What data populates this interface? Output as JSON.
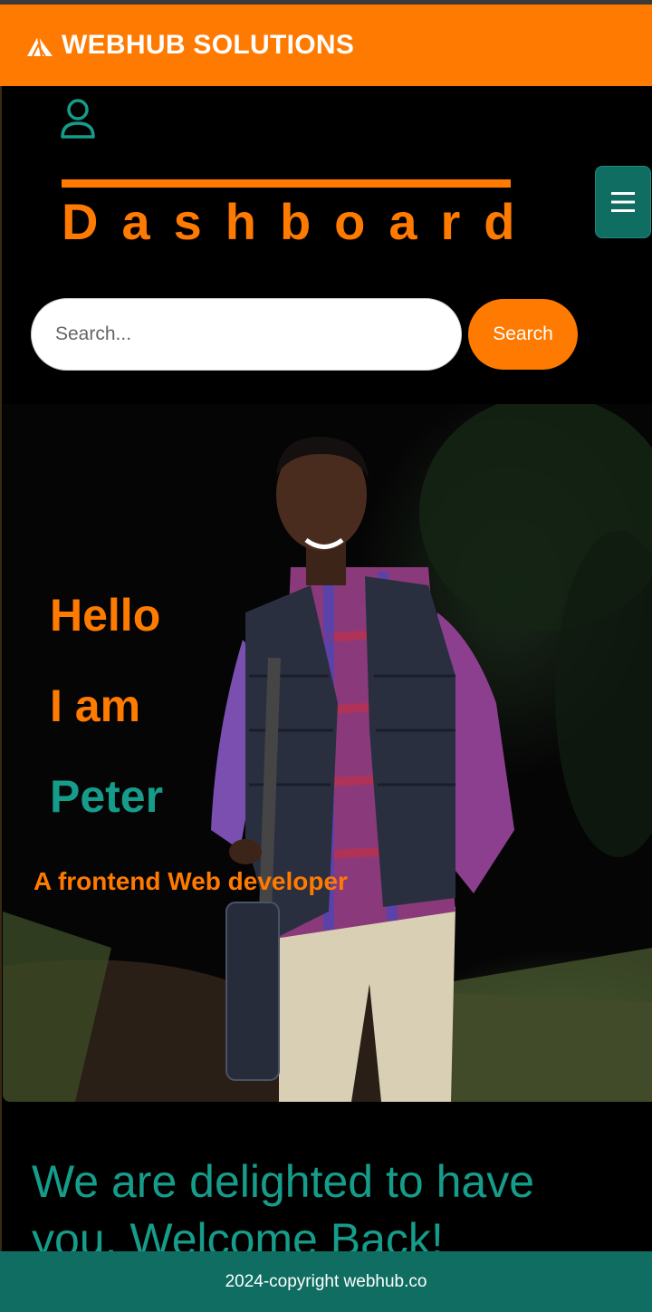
{
  "header": {
    "brand": "WEBHUB SOLUTIONS",
    "brand_icon": "paper-plane-icon",
    "color": "#ff7a00"
  },
  "user": {
    "icon": "user-icon"
  },
  "dashboard": {
    "title": "Dashboard"
  },
  "menu": {
    "icon": "hamburger-menu-icon",
    "color": "#0f6e61"
  },
  "search": {
    "placeholder": "Search...",
    "value": "",
    "button_label": "Search"
  },
  "hero": {
    "line1": "Hello",
    "line2": "I am",
    "name": "Peter",
    "role": "A frontend Web developer"
  },
  "welcome": {
    "text": "We are delighted to have you. Welcome Back!"
  },
  "footer": {
    "copyright": "2024-copyright webhub.co"
  },
  "colors": {
    "accent": "#ff7a00",
    "teal": "#159c8a",
    "background": "#000000"
  }
}
